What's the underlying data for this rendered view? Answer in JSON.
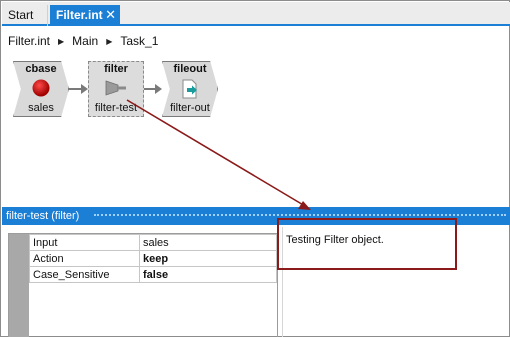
{
  "tabs": [
    {
      "label": "Start"
    },
    {
      "label": "Filter.int",
      "close": "✕"
    }
  ],
  "breadcrumb": [
    "Filter.int",
    "Main",
    "Task_1"
  ],
  "workflow": {
    "nodes": [
      {
        "title": "cbase",
        "label": "sales"
      },
      {
        "title": "filter",
        "label": "filter-test"
      },
      {
        "title": "fileout",
        "label": "filter-out"
      }
    ]
  },
  "panel": {
    "title": "filter-test (filter)",
    "properties": [
      {
        "key": "Input",
        "value": "sales"
      },
      {
        "key": "Action",
        "value": "keep"
      },
      {
        "key": "Case_Sensitive",
        "value": "false"
      }
    ],
    "description": "Testing Filter object."
  },
  "colors": {
    "accent": "#1c7fd6",
    "callout": "#8b1a1a",
    "node_fill": "#d9d9d9"
  }
}
